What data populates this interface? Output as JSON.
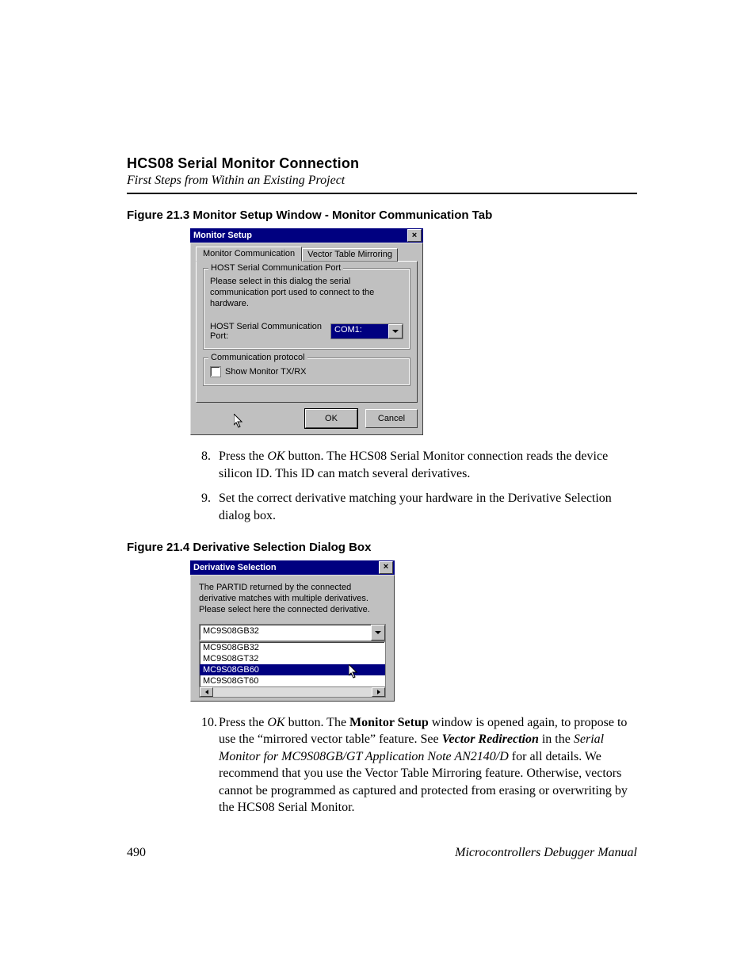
{
  "header": {
    "chapter_title": "HCS08 Serial Monitor Connection",
    "chapter_sub": "First Steps from Within an Existing Project"
  },
  "fig1": {
    "caption": "Figure 21.3  Monitor Setup Window - Monitor Communication Tab",
    "dialog_title": "Monitor Setup",
    "tab_active": "Monitor Communication",
    "tab_inactive": "Vector Table Mirroring",
    "group_host_label": "HOST Serial Communication Port",
    "host_help": "Please select in this dialog the serial communication port used to connect to the hardware.",
    "host_port_label": "HOST Serial Communication Port:",
    "host_port_value": "COM1:",
    "group_proto_label": "Communication protocol",
    "show_tx_rx": "Show Monitor TX/RX",
    "ok": "OK",
    "cancel": "Cancel"
  },
  "step8": {
    "num": "8.",
    "a": "Press the ",
    "ok": "OK",
    "b": " button. The HCS08 Serial Monitor connection reads the device silicon ID. This ID can match several derivatives."
  },
  "step9": {
    "num": "9.",
    "text": "Set the correct derivative matching your hardware in the Derivative Selection dialog box."
  },
  "fig2": {
    "caption": "Figure 21.4  Derivative Selection Dialog Box",
    "dialog_title": "Derivative Selection",
    "help": "The PARTID returned by the connected derivative matches with multiple derivatives.\nPlease select here the connected derivative.",
    "selected": "MC9S08GB32",
    "options": [
      "MC9S08GB32",
      "MC9S08GT32",
      "MC9S08GB60",
      "MC9S08GT60"
    ],
    "highlight": "MC9S08GB60"
  },
  "step10": {
    "num": "10.",
    "a": "Press the ",
    "ok": "OK",
    "b": " button. The ",
    "bold1": "Monitor Setup",
    "c": " window is opened again, to propose to use the “mirrored vector table” feature. See ",
    "boldital1": "Vector Redirection",
    "d": " in the ",
    "ital1": "Serial Monitor for MC9S08GB/GT Application Note AN2140/D",
    "e": " for all details. We recommend that you use the Vector Table Mirroring feature. Otherwise, vectors cannot be programmed as captured and protected from erasing or overwriting by the HCS08 Serial Monitor."
  },
  "footer": {
    "page": "490",
    "manual": "Microcontrollers Debugger Manual"
  }
}
